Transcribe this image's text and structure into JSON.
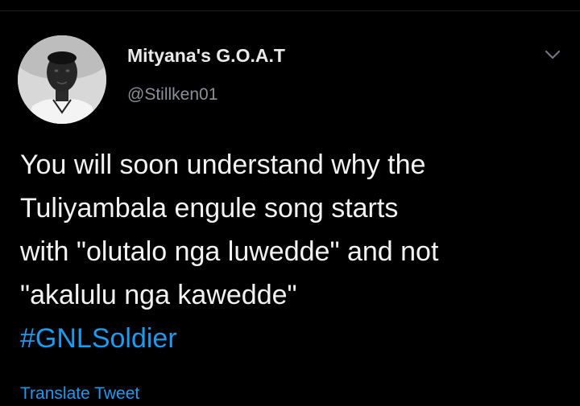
{
  "author": {
    "display_name": "Mityana's G.O.A.T",
    "handle": "@Stillken01",
    "avatar_icon": "user-avatar-photo"
  },
  "menu": {
    "caret_icon": "chevron-down-icon"
  },
  "tweet": {
    "lines": [
      "You will soon understand why the",
      "Tuliyambala engule song starts",
      "with \"olutalo nga luwedde\" and not",
      "\"akalulu nga kawedde\""
    ],
    "hashtag": "#GNLSoldier"
  },
  "actions": {
    "translate_label": "Translate Tweet"
  },
  "colors": {
    "background": "#000000",
    "text": "#f2f2f2",
    "secondary": "#8b9096",
    "link": "#1d9bf0"
  }
}
